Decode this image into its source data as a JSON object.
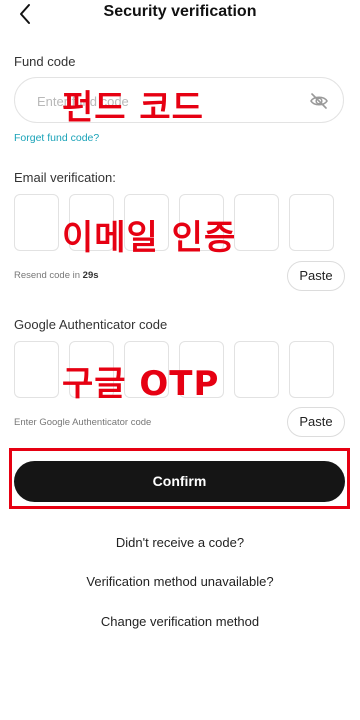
{
  "header": {
    "title": "Security verification"
  },
  "fund_code": {
    "label": "Fund code",
    "placeholder": "Enter fund code",
    "forget_link": "Forget fund code?"
  },
  "email": {
    "label": "Email verification:",
    "resend_prefix": "Resend code in ",
    "resend_seconds": "29s",
    "paste_label": "Paste"
  },
  "google": {
    "label": "Google Authenticator code",
    "hint": "Enter Google Authenticator code",
    "paste_label": "Paste"
  },
  "confirm_label": "Confirm",
  "links": {
    "no_code": "Didn't receive a code?",
    "unavailable": "Verification method unavailable?",
    "change_method": "Change verification method"
  },
  "annotations": {
    "fund": "펀드 코드",
    "email": "이메일 인증",
    "otp": "구글 OTP"
  },
  "colors": {
    "accent_link": "#1aa3b8",
    "annotation": "#e60012",
    "button": "#151515"
  },
  "icons": {
    "back": "chevron-left-icon",
    "visibility": "eye-off-icon"
  }
}
